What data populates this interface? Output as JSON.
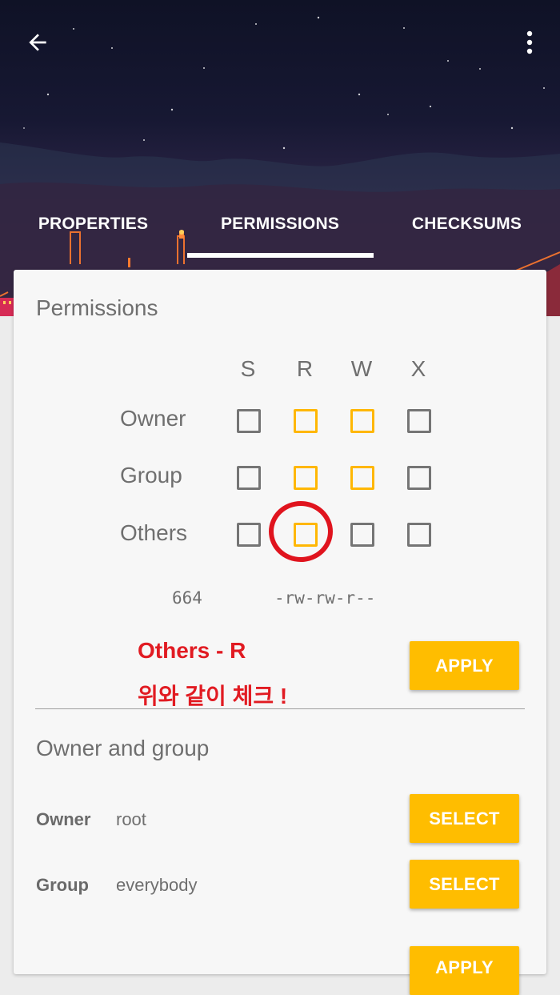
{
  "tabs": [
    {
      "label": "PROPERTIES",
      "selected": false
    },
    {
      "label": "PERMISSIONS",
      "selected": true
    },
    {
      "label": "CHECKSUMS",
      "selected": false
    }
  ],
  "icons": {
    "back": "arrow-back-icon",
    "more": "more-vert-icon"
  },
  "permissions": {
    "title": "Permissions",
    "columns": [
      "S",
      "R",
      "W",
      "X"
    ],
    "rows": [
      {
        "label": "Owner",
        "checked": [
          false,
          true,
          true,
          false
        ]
      },
      {
        "label": "Group",
        "checked": [
          false,
          true,
          true,
          false
        ]
      },
      {
        "label": "Others",
        "checked": [
          false,
          true,
          false,
          false
        ]
      }
    ],
    "octal": "664",
    "symbolic": "-rw-rw-r--",
    "apply_label": "APPLY"
  },
  "annotation": {
    "line1": "Others - R",
    "line2": "위와 같이 체크 !"
  },
  "owner_group": {
    "title": "Owner and group",
    "owner_label": "Owner",
    "owner_value": "root",
    "group_label": "Group",
    "group_value": "everybody",
    "select_label": "SELECT",
    "apply_label": "APPLY"
  },
  "colors": {
    "accent": "#ffbd00",
    "checked": "#ffb703",
    "annotation": "#e11b22"
  }
}
